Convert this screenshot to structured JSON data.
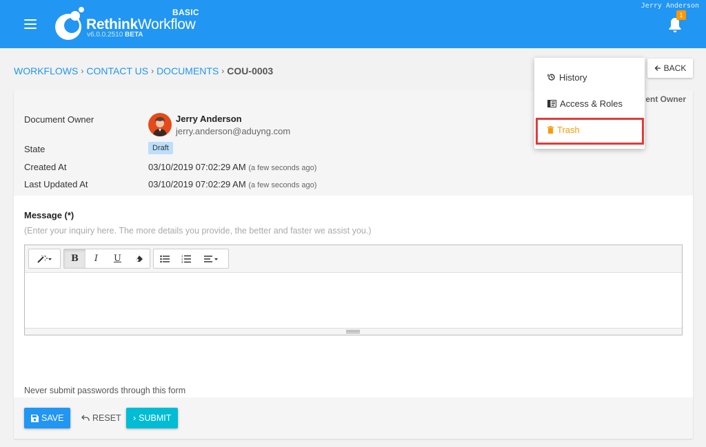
{
  "header": {
    "brand_bold": "Rethink",
    "brand_light": "Workflow",
    "version": "v6.0.0.2510",
    "version_tag": "BETA",
    "plan": "BASIC",
    "user_name": "Jerry Anderson",
    "notification_count": "1",
    "accent_color": "#2196f3"
  },
  "breadcrumb": {
    "items": [
      "WORKFLOWS",
      "CONTACT US",
      "DOCUMENTS"
    ],
    "current": "COU-0003"
  },
  "back_label": "BACK",
  "dropdown": {
    "items": [
      {
        "label": "History",
        "icon": "history-icon"
      },
      {
        "label": "Access & Roles",
        "icon": "id-card-icon"
      },
      {
        "label": "Trash",
        "icon": "trash-icon"
      }
    ]
  },
  "details": {
    "obscured_text": "ent Owner",
    "owner_label": "Document Owner",
    "owner_name": "Jerry Anderson",
    "owner_email": "jerry.anderson@aduyng.com",
    "state_label": "State",
    "state_value": "Draft",
    "created_label": "Created At",
    "created_value": "03/10/2019 07:02:29 AM",
    "created_relative": "(a few seconds ago)",
    "updated_label": "Last Updated At",
    "updated_value": "03/10/2019 07:02:29 AM",
    "updated_relative": "(a few seconds ago)"
  },
  "message": {
    "label": "Message (*)",
    "hint": "(Enter your inquiry here. The more details you provide, the better and faster we assist you.)",
    "value": ""
  },
  "note": "Never submit passwords through this form",
  "actions": {
    "save": "SAVE",
    "reset": "RESET",
    "submit": "SUBMIT"
  }
}
